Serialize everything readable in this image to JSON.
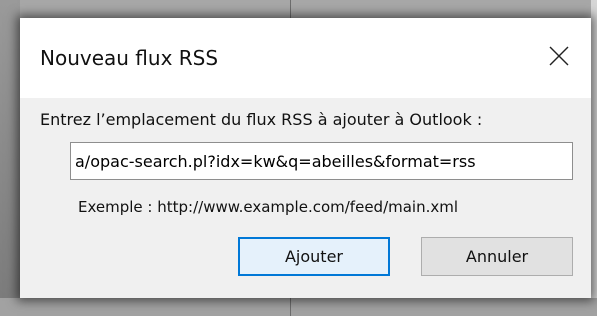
{
  "dialog": {
    "title": "Nouveau flux RSS",
    "close_icon": "close-icon",
    "prompt": "Entrez l’emplacement du flux RSS à ajouter à Outlook :",
    "url_value": "a/opac-search.pl?idx=kw&q=abeilles&format=rss",
    "example": "Exemple : http://www.example.com/feed/main.xml",
    "add_label": "Ajouter",
    "cancel_label": "Annuler"
  },
  "colors": {
    "accent": "#0078d7",
    "dialog_bg": "#f0f0f0",
    "titlebar_bg": "#ffffff"
  }
}
